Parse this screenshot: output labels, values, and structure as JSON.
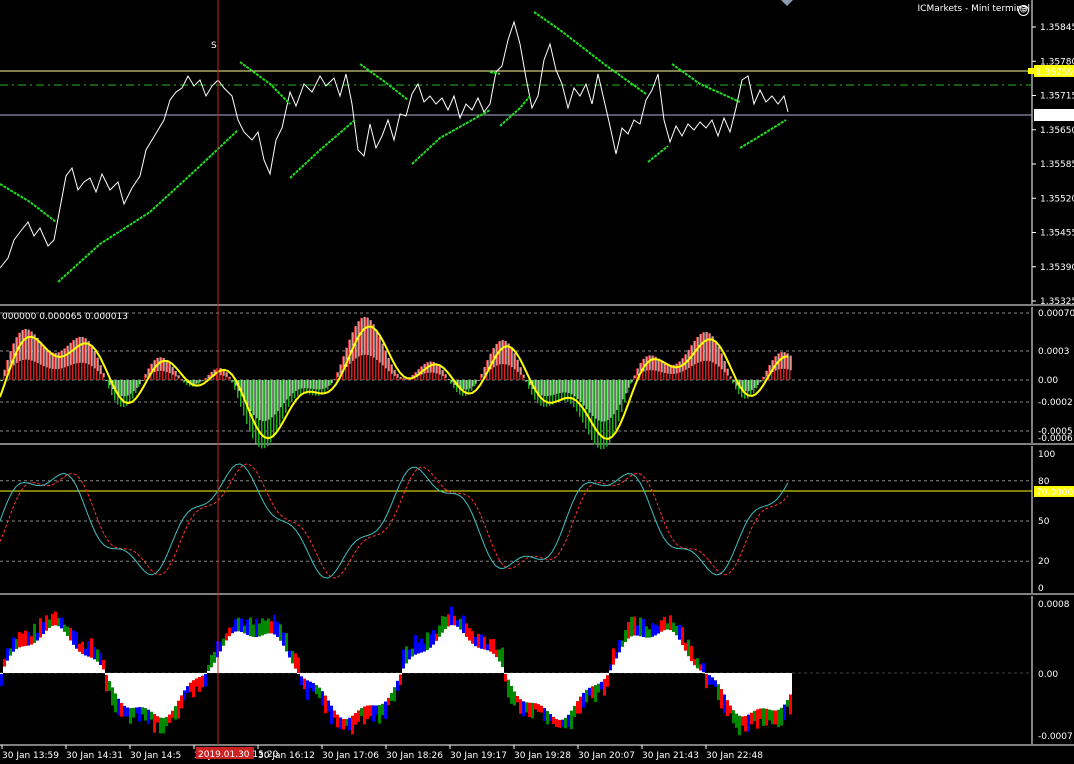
{
  "terminal": {
    "title": "ICMarkets - Mini terminal"
  },
  "chart_data": [
    {
      "type": "line",
      "name": "price",
      "y_ticks": [
        "1.35845",
        "1.35780",
        "1.35715",
        "1.35650",
        "1.35585",
        "1.35520",
        "1.35455",
        "1.35390",
        "1.35325"
      ],
      "ylim": [
        1.35325,
        1.35845
      ],
      "level_yellow": "1.35759",
      "level_white": "1.35677",
      "marker": "S",
      "colors": {
        "price": "#ffffff",
        "bands": "#22dd22",
        "level_yellow": "#ffff00",
        "level_white": "#a0a0c0"
      }
    },
    {
      "type": "bar",
      "name": "macd",
      "params_label": "000000 0.000065 0.000013",
      "y_ticks": [
        "0.00070",
        "0.0003",
        "0.00",
        "-0.0002",
        "-0.0005"
      ],
      "ylim_top_label": "0.00070",
      "ylim_bottom_label": "-0.00061",
      "colors": {
        "up": "#cc2222",
        "down": "#22aa22",
        "signal": "#ffff00"
      }
    },
    {
      "type": "line",
      "name": "stochastic",
      "y_ticks": [
        "100",
        "80",
        "50",
        "20",
        "0"
      ],
      "level_label": "70.0000",
      "ylim": [
        0,
        100
      ],
      "colors": {
        "main": "#40c0c0",
        "signal": "#ff3333",
        "level": "#ffff00"
      }
    },
    {
      "type": "area",
      "name": "histogram",
      "y_ticks": [
        "0.0008",
        "0.00",
        "-0.0007"
      ],
      "colors": {
        "main": "#ffffff",
        "red": "#ff0000",
        "blue": "#0000ff",
        "green": "#008800"
      }
    }
  ],
  "x_ticks": [
    "30 Jan 13:59",
    "30 Jan 14:31",
    "30 Jan 14:5",
    "30 Jan 15:38",
    "30 Jan 16:12",
    "30 Jan 17:06",
    "30 Jan 18:26",
    "30 Jan 19:17",
    "30 Jan 19:28",
    "30 Jan 20:07",
    "30 Jan 21:43",
    "30 Jan 22:48"
  ],
  "cursor_label": "2019.01.30 15:20"
}
